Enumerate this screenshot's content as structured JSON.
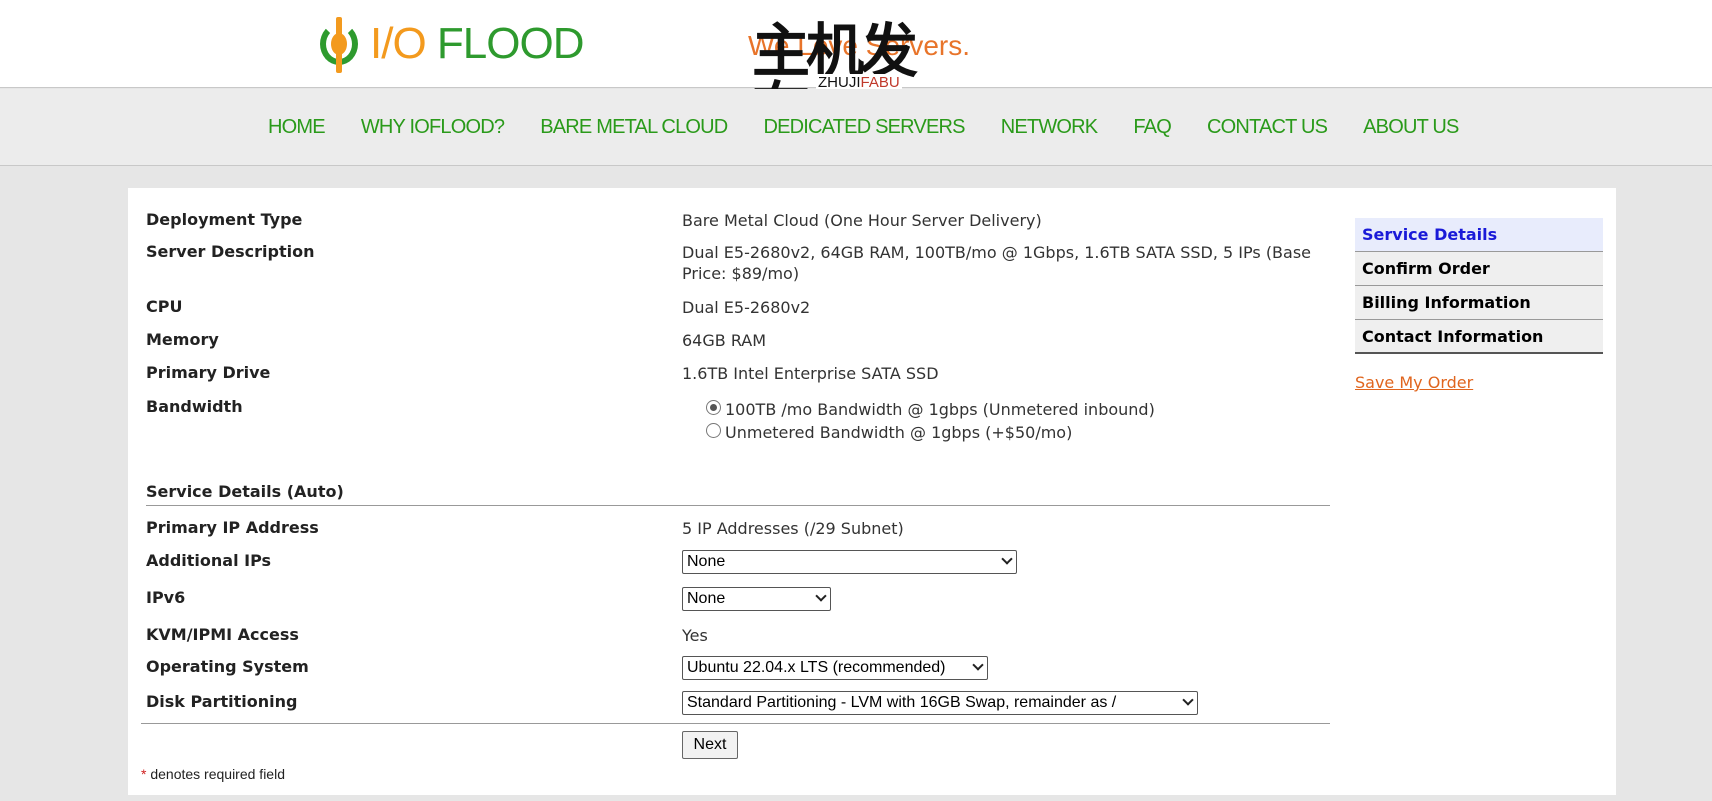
{
  "header": {
    "logo_text_io": "I/O",
    "logo_text_flood": " FLOOD",
    "tagline": "We Love Servers.",
    "watermark_cn": "主机发布",
    "watermark_en_a": "ZHUJI",
    "watermark_en_b": "FABU"
  },
  "nav": {
    "items": [
      "HOME",
      "WHY IOFLOOD?",
      "BARE METAL CLOUD",
      "DEDICATED SERVERS",
      "NETWORK",
      "FAQ",
      "CONTACT US",
      "ABOUT US"
    ]
  },
  "details": {
    "deployment_type": {
      "label": "Deployment Type",
      "value": "Bare Metal Cloud (One Hour Server Delivery)"
    },
    "server_description": {
      "label": "Server Description",
      "value": "Dual E5-2680v2, 64GB RAM, 100TB/mo @ 1Gbps, 1.6TB SATA SSD, 5 IPs (Base Price: $89/mo)"
    },
    "cpu": {
      "label": "CPU",
      "value": "Dual E5-2680v2"
    },
    "memory": {
      "label": "Memory",
      "value": "64GB RAM"
    },
    "primary_drive": {
      "label": "Primary Drive",
      "value": "1.6TB Intel Enterprise SATA SSD"
    },
    "bandwidth": {
      "label": "Bandwidth",
      "options": [
        {
          "label": "100TB /mo Bandwidth @ 1gbps (Unmetered inbound)",
          "selected": true
        },
        {
          "label": "Unmetered Bandwidth @ 1gbps (+$50/mo)",
          "selected": false
        }
      ]
    }
  },
  "service": {
    "heading": "Service Details (Auto)",
    "primary_ip": {
      "label": "Primary IP Address",
      "value": "5 IP Addresses (/29 Subnet)"
    },
    "additional_ips": {
      "label": "Additional IPs",
      "selected": "None"
    },
    "ipv6": {
      "label": "IPv6",
      "selected": "None"
    },
    "kvm": {
      "label": "KVM/IPMI Access",
      "value": "Yes"
    },
    "os": {
      "label": "Operating System",
      "selected": "Ubuntu 22.04.x LTS (recommended)"
    },
    "partitioning": {
      "label": "Disk Partitioning",
      "selected": "Standard Partitioning - LVM with 16GB Swap, remainder as /"
    }
  },
  "form": {
    "next_label": "Next",
    "required_star": "*",
    "required_note": " denotes required field"
  },
  "steps": {
    "items": [
      "Service Details",
      "Confirm Order",
      "Billing Information",
      "Contact Information"
    ],
    "active_index": 0,
    "save_label": "Save My Order"
  },
  "colors": {
    "nav_green": "#2a9a1a",
    "accent_orange": "#e0651e",
    "active_step_blue": "#1a1ad8"
  }
}
